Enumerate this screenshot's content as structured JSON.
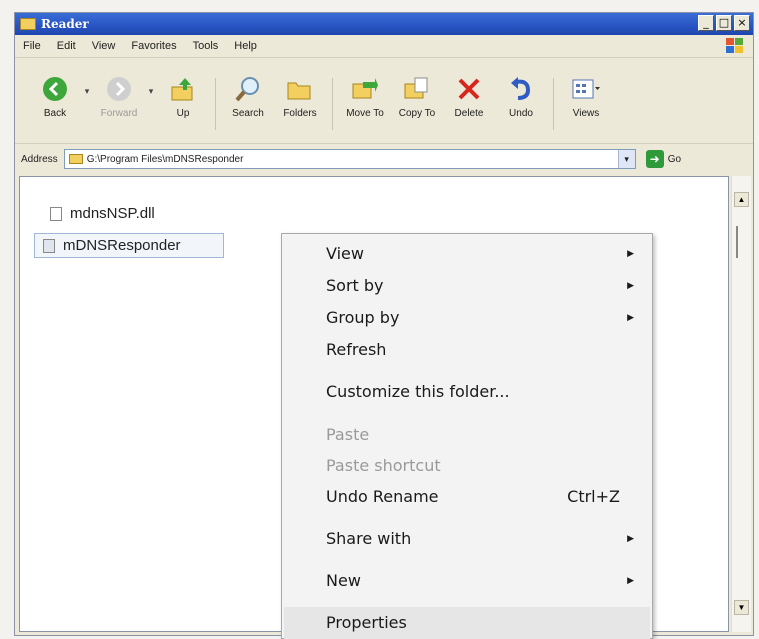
{
  "window": {
    "title": "Reader",
    "controls": [
      "_",
      "□",
      "×"
    ]
  },
  "menubar": [
    "File",
    "Edit",
    "View",
    "Favorites",
    "Tools",
    "Help"
  ],
  "toolbar": {
    "back": "Back",
    "forward": "Forward",
    "up": "Up",
    "search": "Search",
    "folders": "Folders",
    "moveto": "Move To",
    "copyto": "Copy To",
    "delete": "Delete",
    "undo": "Undo",
    "views": "Views"
  },
  "address": {
    "label": "Address",
    "value": "G:\\Program Files\\mDNSResponder",
    "go": "Go"
  },
  "files": [
    "mdnsNSP.dll",
    "mDNSResponder"
  ],
  "context_menu": {
    "view": "View",
    "sort_by": "Sort by",
    "group_by": "Group by",
    "refresh": "Refresh",
    "customize": "Customize this folder...",
    "paste": "Paste",
    "paste_shortcut": "Paste shortcut",
    "undo_rename": "Undo Rename",
    "undo_shortcut": "Ctrl+Z",
    "share_with": "Share with",
    "new": "New",
    "properties": "Properties"
  },
  "colors": {
    "titlebar": "#2754c2",
    "window_bg": "#ece9d8",
    "menu_bg": "#f3f3f3"
  }
}
